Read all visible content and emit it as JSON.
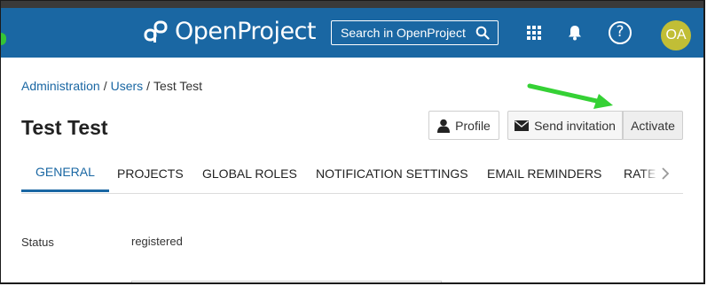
{
  "header": {
    "logo_text": "OpenProject",
    "search_placeholder": "Search in OpenProject",
    "avatar_initials": "OA",
    "help_label": "?"
  },
  "breadcrumb": {
    "items": [
      "Administration",
      "Users"
    ],
    "current": "Test Test"
  },
  "page": {
    "title": "Test Test"
  },
  "toolbar": {
    "profile_label": "Profile",
    "send_invitation_label": "Send invitation",
    "activate_label": "Activate"
  },
  "tabs": [
    {
      "label": "GENERAL",
      "active": true
    },
    {
      "label": "PROJECTS"
    },
    {
      "label": "GLOBAL ROLES"
    },
    {
      "label": "NOTIFICATION SETTINGS"
    },
    {
      "label": "EMAIL REMINDERS"
    },
    {
      "label": "RATE"
    }
  ],
  "form": {
    "status_label": "Status",
    "status_value": "registered"
  },
  "colors": {
    "header_bg": "#1a67a3",
    "avatar_bg": "#c1be36",
    "annotation_arrow": "#35d135"
  }
}
